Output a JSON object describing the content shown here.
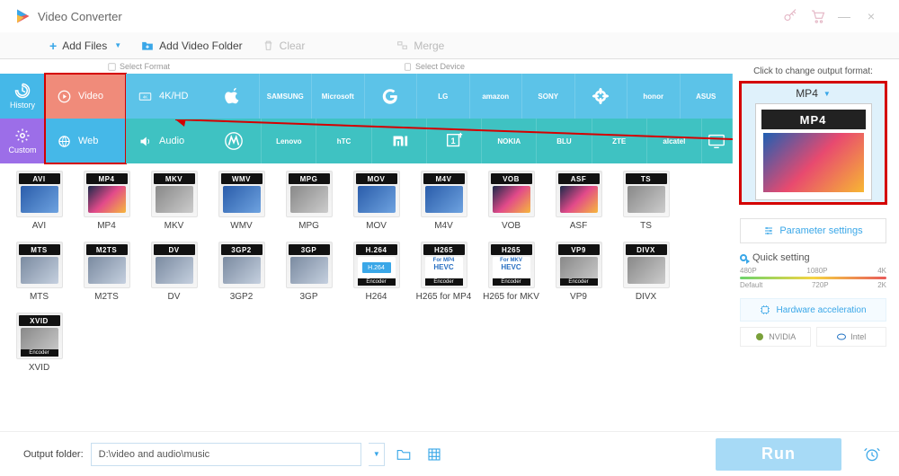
{
  "app": {
    "title": "Video Converter"
  },
  "titlebar_buttons": {
    "minimize": "—",
    "close": "×"
  },
  "toolbar": {
    "add_files": "Add Files",
    "add_folder": "Add Video Folder",
    "clear": "Clear",
    "merge": "Merge"
  },
  "strip_header": {
    "select_format": "Select Format",
    "select_device": "Select Device"
  },
  "side_tabs": {
    "history": "History",
    "custom": "Custom"
  },
  "categories": {
    "video": "Video",
    "hd": "4K/HD",
    "web": "Web",
    "audio": "Audio"
  },
  "brands_row1": [
    "apple",
    "samsung",
    "microsoft",
    "google",
    "lg",
    "amazon",
    "sony",
    "huawei",
    "honor",
    "asus"
  ],
  "brand_labels_row1": {
    "samsung": "SAMSUNG",
    "microsoft": "Microsoft",
    "lg": "LG",
    "amazon": "amazon",
    "sony": "SONY",
    "huawei": "HUAWEI",
    "honor": "honor",
    "asus": "ASUS"
  },
  "brands_row2": [
    "motorola",
    "lenovo",
    "htc",
    "xiaomi",
    "oneplus",
    "nokia",
    "blu",
    "zte",
    "alcatel",
    "tv"
  ],
  "brand_labels_row2": {
    "lenovo": "Lenovo",
    "htc": "hTC",
    "nokia": "NOKIA",
    "blu": "BLU",
    "zte": "ZTE",
    "alcatel": "alcatel",
    "tv": "TV"
  },
  "formats": [
    {
      "code": "AVI",
      "label": "AVI",
      "art": "art-blue"
    },
    {
      "code": "MP4",
      "label": "MP4",
      "art": "art-film"
    },
    {
      "code": "MKV",
      "label": "MKV",
      "art": "art-gray"
    },
    {
      "code": "WMV",
      "label": "WMV",
      "art": "art-blue"
    },
    {
      "code": "MPG",
      "label": "MPG",
      "art": "art-gray"
    },
    {
      "code": "MOV",
      "label": "MOV",
      "art": "art-blue"
    },
    {
      "code": "M4V",
      "label": "M4V",
      "art": "art-blue"
    },
    {
      "code": "VOB",
      "label": "VOB",
      "art": "art-film"
    },
    {
      "code": "ASF",
      "label": "ASF",
      "art": "art-film"
    },
    {
      "code": "TS",
      "label": "TS",
      "art": "art-gray"
    },
    {
      "code": "MTS",
      "label": "MTS",
      "art": "art-cam"
    },
    {
      "code": "M2TS",
      "label": "M2TS",
      "art": "art-cam"
    },
    {
      "code": "DV",
      "label": "DV",
      "art": "art-cam"
    },
    {
      "code": "3GP2",
      "label": "3GP2",
      "art": "art-cam"
    },
    {
      "code": "3GP",
      "label": "3GP",
      "art": "art-cam"
    },
    {
      "code": "H.264",
      "label": "H264",
      "art": "art-h264",
      "encoder": true
    },
    {
      "code": "H265",
      "label": "H265 for MP4",
      "art": "art-hevc",
      "sub": "For MP4",
      "sub2": "HEVC",
      "encoder": true
    },
    {
      "code": "H265",
      "label": "H265 for MKV",
      "art": "art-hevc",
      "sub": "For MKV",
      "sub2": "HEVC",
      "encoder": true
    },
    {
      "code": "VP9",
      "label": "VP9",
      "art": "art-gray",
      "encoder": true
    },
    {
      "code": "DIVX",
      "label": "DIVX",
      "art": "art-gray"
    },
    {
      "code": "XVID",
      "label": "XVID",
      "art": "art-gray",
      "encoder": true
    }
  ],
  "right": {
    "hint": "Click to change output format:",
    "selected_format": "MP4",
    "param_btn": "Parameter settings",
    "quick": "Quick setting",
    "ticks_top": [
      "480P",
      "1080P",
      "4K"
    ],
    "ticks_bottom": [
      "Default",
      "720P",
      "2K"
    ],
    "hw": "Hardware acceleration",
    "chip_nvidia": "NVIDIA",
    "chip_intel": "Intel"
  },
  "bottom": {
    "label": "Output folder:",
    "path": "D:\\video and audio\\music",
    "run": "Run"
  }
}
